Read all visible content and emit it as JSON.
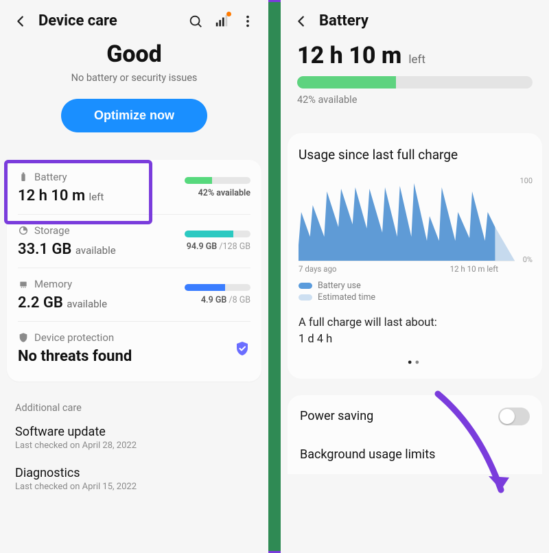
{
  "left": {
    "title": "Device care",
    "hero_status": "Good",
    "hero_sub": "No battery or security issues",
    "optimize_btn": "Optimize now",
    "battery": {
      "label": "Battery",
      "time": "12 h 10 m",
      "unit": "left",
      "pct": 42,
      "pct_text": "42% available"
    },
    "storage": {
      "label": "Storage",
      "value": "33.1 GB",
      "unit": "available",
      "used": 94.9,
      "total": 128,
      "used_text": "94.9 GB",
      "total_text": "/128 GB"
    },
    "memory": {
      "label": "Memory",
      "value": "2.2 GB",
      "unit": "available",
      "used": 4.9,
      "total": 8,
      "used_text": "4.9 GB",
      "total_text": "/8 GB"
    },
    "protection": {
      "label": "Device protection",
      "value": "No threats found"
    },
    "additional_hdr": "Additional care",
    "software_update": {
      "title": "Software update",
      "sub": "Last checked on April 28, 2022"
    },
    "diagnostics": {
      "title": "Diagnostics",
      "sub": "Last checked on April 15, 2022"
    }
  },
  "right": {
    "title": "Battery",
    "time": "12 h 10 m",
    "time_unit": "left",
    "pct": 42,
    "pct_text": "42% available",
    "usage_title": "Usage since last full charge",
    "x_left": "7 days ago",
    "x_right": "12 h 10 m left",
    "y_top": "100",
    "y_bot": "0%",
    "legend_use": "Battery use",
    "legend_est": "Estimated time",
    "full_charge_lead": "A full charge will last about:",
    "full_charge_value": "1 d 4 h",
    "power_saving": "Power saving",
    "bg_limits": "Background usage limits"
  },
  "chart_data": {
    "type": "area",
    "title": "Usage since last full charge",
    "xlabel": "",
    "ylabel": "%",
    "ylim": [
      0,
      100
    ],
    "x": [
      0,
      0.1,
      0.4,
      0.5,
      0.9,
      1.0,
      1.4,
      1.5,
      1.9,
      2.0,
      2.4,
      2.5,
      2.95,
      3.0,
      3.45,
      3.5,
      3.95,
      4.0,
      4.5,
      4.6,
      4.95,
      5.0,
      5.5,
      5.6,
      6.0,
      6.1,
      6.55,
      6.6,
      6.9
    ],
    "series": [
      {
        "name": "Battery use",
        "values": [
          20,
          60,
          30,
          68,
          30,
          85,
          42,
          88,
          45,
          90,
          40,
          88,
          35,
          90,
          30,
          92,
          30,
          95,
          25,
          55,
          25,
          90,
          25,
          60,
          28,
          85,
          25,
          60,
          42
        ]
      },
      {
        "name": "Estimated time",
        "x": [
          6.9,
          7.6
        ],
        "values": [
          42,
          0
        ]
      }
    ],
    "x_tick_labels": [
      "7 days ago",
      "",
      "",
      "",
      "",
      "",
      "",
      "12 h 10 m left"
    ]
  }
}
